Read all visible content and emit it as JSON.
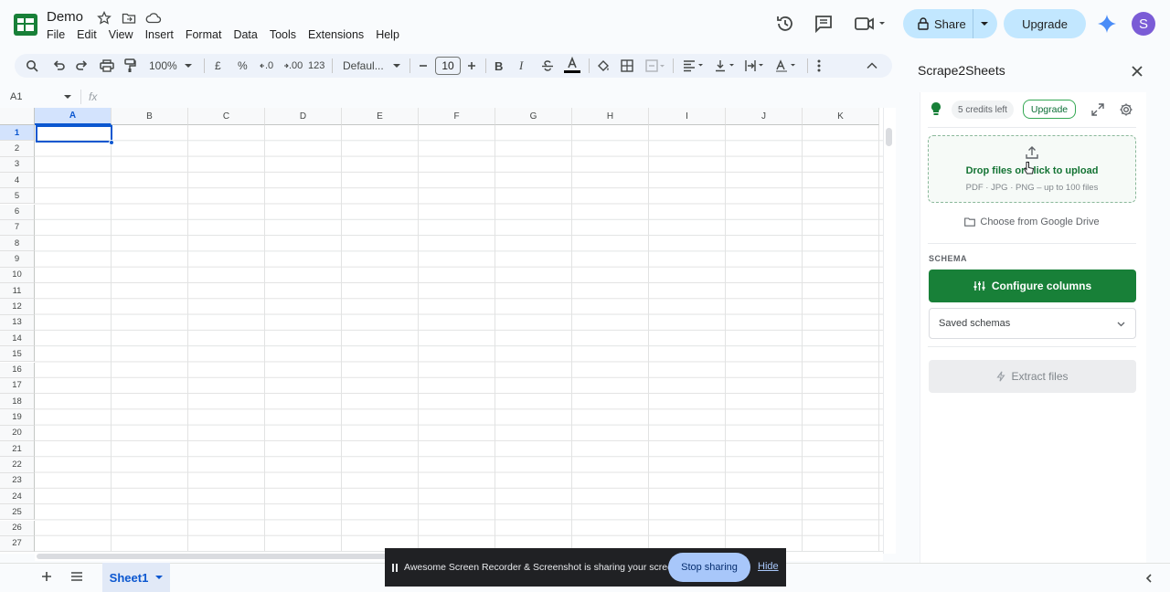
{
  "header": {
    "doc_title": "Demo",
    "menu": [
      "File",
      "Edit",
      "View",
      "Insert",
      "Format",
      "Data",
      "Tools",
      "Extensions",
      "Help"
    ],
    "share_label": "Share",
    "upgrade_label": "Upgrade",
    "avatar_initial": "S"
  },
  "toolbar": {
    "zoom": "100%",
    "currency": "£",
    "percent": "%",
    "dec_decrease": ".0",
    "dec_increase": ".00",
    "number_format": "123",
    "font": "Defaul...",
    "font_size": "10"
  },
  "formula_bar": {
    "name_box": "A1",
    "fx": "fx"
  },
  "grid": {
    "columns": [
      "A",
      "B",
      "C",
      "D",
      "E",
      "F",
      "G",
      "H",
      "I",
      "J",
      "K"
    ],
    "rows": [
      "1",
      "2",
      "3",
      "4",
      "5",
      "6",
      "7",
      "8",
      "9",
      "10",
      "11",
      "12",
      "13",
      "14",
      "15",
      "16",
      "17",
      "18",
      "19",
      "20",
      "21",
      "22",
      "23",
      "24",
      "25",
      "26",
      "27"
    ],
    "selected_cell": "A1"
  },
  "sheets": {
    "tabs": [
      "Sheet1"
    ]
  },
  "share_banner": {
    "text": "Awesome Screen Recorder & Screenshot is sharing your screen.",
    "stop_label": "Stop sharing",
    "hide_label": "Hide"
  },
  "side_panel": {
    "title": "Scrape2Sheets",
    "credits": "5 credits left",
    "upgrade_label": "Upgrade",
    "drop_main": "Drop files or click to upload",
    "drop_sub": "PDF · JPG · PNG – up to 100 files",
    "google_drive": "Choose from Google Drive",
    "schema_label": "SCHEMA",
    "configure_label": "Configure columns",
    "saved_schemas": "Saved schemas",
    "extract_label": "Extract files"
  },
  "colors": {
    "accent_green": "#188038",
    "selection_blue": "#0b57d0",
    "share_bg": "#c2e7ff"
  }
}
